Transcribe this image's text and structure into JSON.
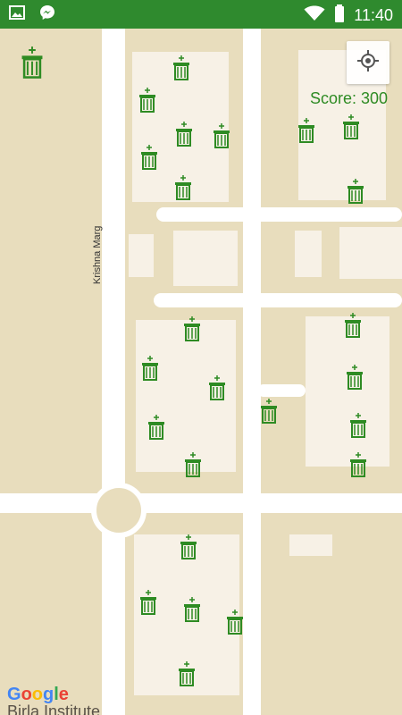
{
  "status_bar": {
    "time": "11:40",
    "left_icons": [
      "image-icon",
      "messenger-icon"
    ],
    "right_icons": [
      "wifi-icon",
      "battery-icon"
    ]
  },
  "map": {
    "street_label": "Krishna Marg",
    "google_logo": "Google",
    "bottom_label": "Birla Institute",
    "dustbin_icon": "dustbin-icon",
    "my_location_button_icon": "my-location-icon"
  },
  "score_text": "Score: 300",
  "colors": {
    "status_bar": "#2f8a2e",
    "bin_green": "#2e8b23",
    "map_background": "#e8ddbd",
    "road": "#ffffff",
    "building": "#f7f1e6"
  }
}
